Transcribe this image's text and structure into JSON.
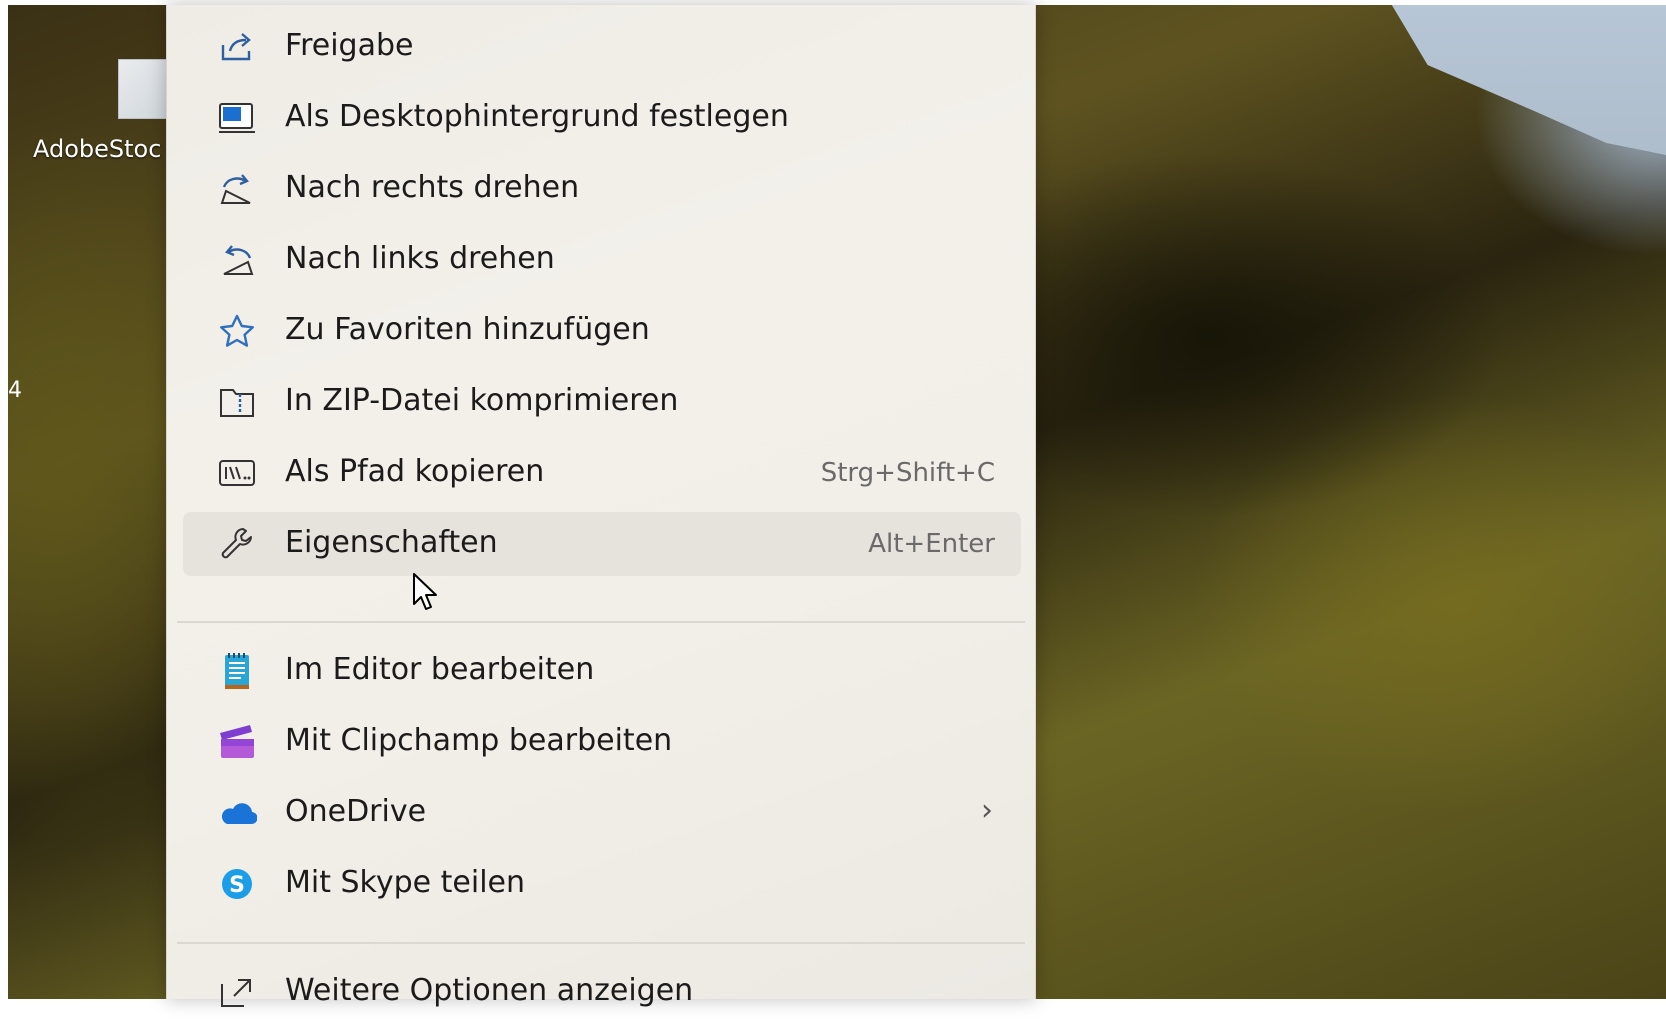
{
  "desktop": {
    "icon_label": "AdobeStoc",
    "edge_glyph": "4"
  },
  "context_menu": {
    "items": [
      {
        "label": "Freigabe",
        "icon": "share-icon"
      },
      {
        "label": "Als Desktophintergrund festlegen",
        "icon": "desktop-background-icon"
      },
      {
        "label": "Nach rechts drehen",
        "icon": "rotate-right-icon"
      },
      {
        "label": "Nach links drehen",
        "icon": "rotate-left-icon"
      },
      {
        "label": "Zu Favoriten hinzufügen",
        "icon": "star-icon"
      },
      {
        "label": "In ZIP-Datei komprimieren",
        "icon": "zip-folder-icon"
      },
      {
        "label": "Als Pfad kopieren",
        "icon": "copy-path-icon",
        "shortcut": "Strg+Shift+C"
      },
      {
        "label": "Eigenschaften",
        "icon": "wrench-icon",
        "shortcut": "Alt+Enter"
      }
    ],
    "apps": [
      {
        "label": "Im Editor bearbeiten",
        "icon": "notepad-icon"
      },
      {
        "label": "Mit Clipchamp bearbeiten",
        "icon": "clipchamp-icon"
      },
      {
        "label": "OneDrive",
        "icon": "onedrive-icon",
        "has_submenu": true
      },
      {
        "label": "Mit Skype teilen",
        "icon": "skype-icon"
      }
    ],
    "more": {
      "label": "Weitere Optionen anzeigen",
      "icon": "more-options-icon"
    }
  },
  "colors": {
    "menu_bg": "#f1eee8",
    "hover_bg": "#e6e3dd",
    "text": "#1b1b1b",
    "shortcut_text": "#6a6a6a",
    "accent_blue": "#1a6fd0"
  }
}
